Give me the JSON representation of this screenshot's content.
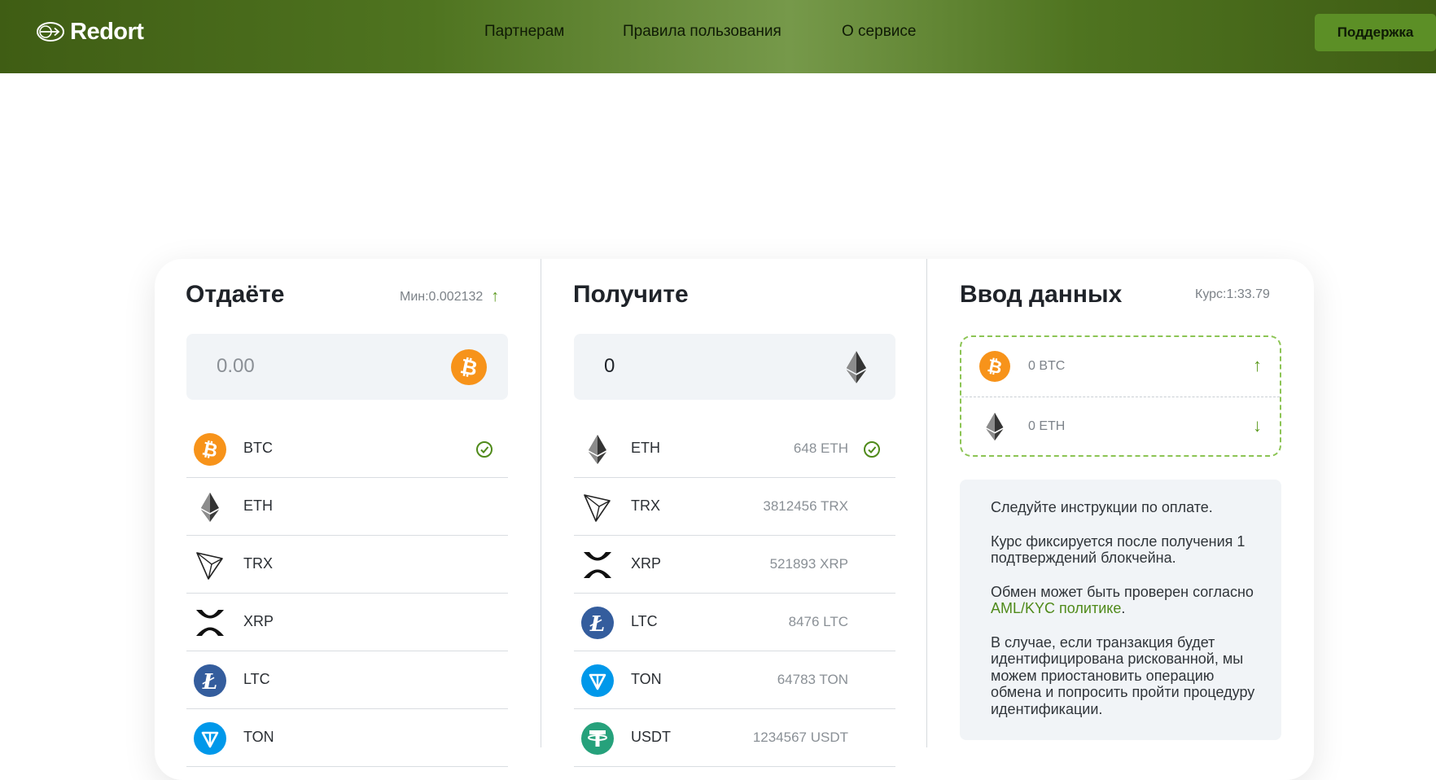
{
  "header": {
    "logo_text": "Redort",
    "nav": [
      "Партнерам",
      "Правила пользования",
      "О сервисе"
    ],
    "support_label": "Поддержка"
  },
  "give": {
    "title": "Отдаёте",
    "min_label": "Мин:0.002132",
    "amount": "0.00",
    "coins": [
      "BTC",
      "ETH",
      "TRX",
      "XRP",
      "LTC",
      "TON"
    ],
    "selected": "BTC"
  },
  "receive": {
    "title": "Получите",
    "amount": "0",
    "coins": [
      {
        "symbol": "ETH",
        "reserve": "648 ETH"
      },
      {
        "symbol": "TRX",
        "reserve": "3812456 TRX"
      },
      {
        "symbol": "XRP",
        "reserve": "521893 XRP"
      },
      {
        "symbol": "LTC",
        "reserve": "8476 LTC"
      },
      {
        "symbol": "TON",
        "reserve": "64783 TON"
      },
      {
        "symbol": "USDT",
        "reserve": "1234567 USDT"
      }
    ],
    "selected": "ETH"
  },
  "input_data": {
    "title": "Ввод данных",
    "rate_label": "Курс:1:33.79",
    "send_value": "0 BTC",
    "receive_value": "0 ETH",
    "info_p1": "Следуйте инструкции по оплате.",
    "info_p2": "Курс фиксируется после получения 1 подтверждений блокчейна.",
    "info_p3_prefix": "Обмен может быть проверен согласно ",
    "info_p3_link": "AML/KYC политике",
    "info_p3_suffix": ".",
    "info_p4": "В случае, если транзакция будет идентифицирована рискованной, мы можем приостановить операцию обмена и попросить пройти процедуру идентификации."
  },
  "colors": {
    "accent": "#5c9a1f",
    "header_dark": "#3f5d14",
    "btc": "#f7931a",
    "ltc": "#345d9d",
    "ton": "#0098ea",
    "usdt": "#26a17b"
  }
}
